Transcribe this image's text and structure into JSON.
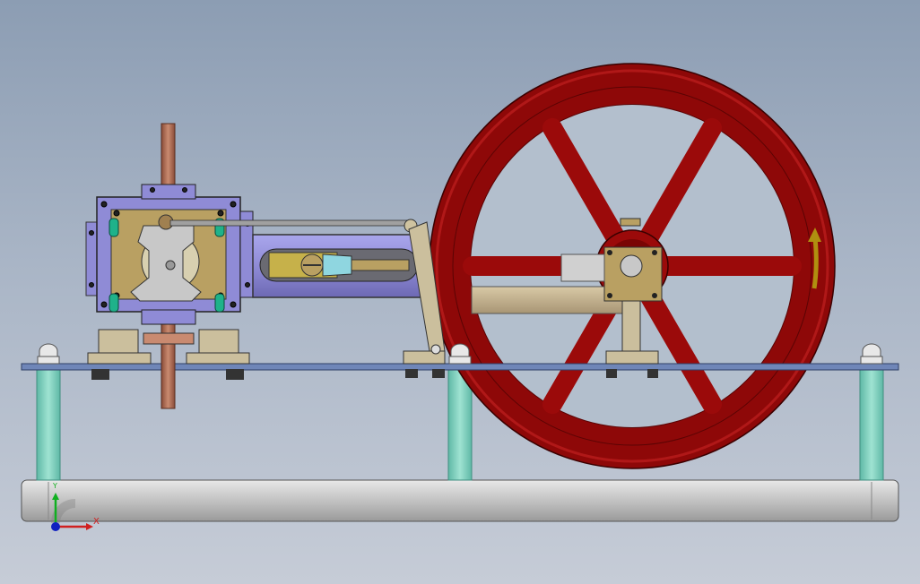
{
  "viewport": {
    "background_top": "#8c9db3",
    "background_bottom": "#c6ccd7"
  },
  "model": {
    "flywheel_color": "#9b0a0a",
    "cylinder_color": "#8f8bd6",
    "valve_chest_color": "#b9a062",
    "base_plate_color": "#6f86b8",
    "pillar_color": "#7fd0bf",
    "rod_color": "#b07058",
    "rotation_arrow_icon": "curved-arrow-up-icon",
    "rotation_arrow_color": "#b08f10"
  },
  "triad": {
    "x_label": "X",
    "y_label": "Y",
    "x_color": "#d02020",
    "y_color": "#10b020",
    "z_color": "#1020c0"
  }
}
